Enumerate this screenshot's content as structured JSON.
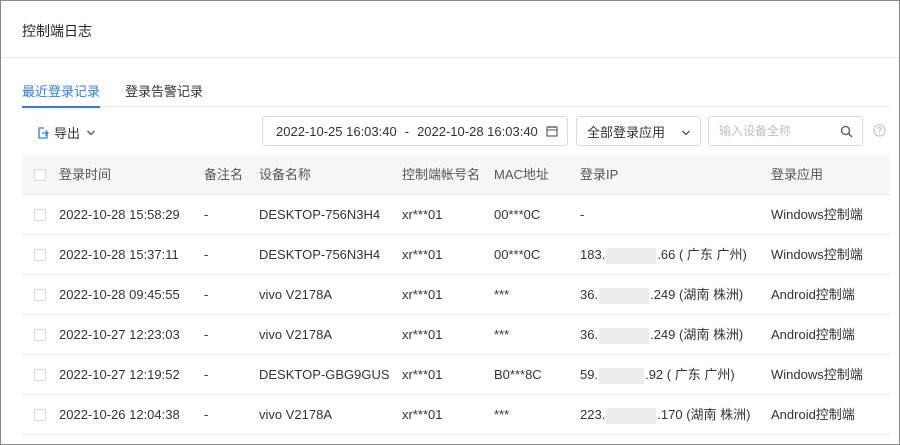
{
  "page": {
    "title": "控制端日志"
  },
  "tabs": [
    {
      "label": "最近登录记录",
      "active": true
    },
    {
      "label": "登录告警记录",
      "active": false
    }
  ],
  "toolbar": {
    "export_label": "导出",
    "date_start": "2022-10-25 16:03:40",
    "date_sep": "-",
    "date_end": "2022-10-28 16:03:40",
    "app_select_value": "全部登录应用",
    "search_placeholder": "输入设备全称"
  },
  "table": {
    "columns": [
      "登录时间",
      "备注名",
      "设备名称",
      "控制端帐号名",
      "MAC地址",
      "登录IP",
      "登录应用"
    ],
    "rows": [
      {
        "time": "2022-10-28 15:58:29",
        "remark": "-",
        "device": "DESKTOP-756N3H4",
        "account": "xr***01",
        "mac": "00***0C",
        "ip_prefix": "-",
        "ip_suffix": "",
        "app": "Windows控制端"
      },
      {
        "time": "2022-10-28 15:37:11",
        "remark": "-",
        "device": "DESKTOP-756N3H4",
        "account": "xr***01",
        "mac": "00***0C",
        "ip_prefix": "183.",
        "ip_suffix": ".66 ( 广东 广州)",
        "app": "Windows控制端"
      },
      {
        "time": "2022-10-28 09:45:55",
        "remark": "-",
        "device": "vivo V2178A",
        "account": "xr***01",
        "mac": "***",
        "ip_prefix": "36.",
        "ip_suffix": ".249 (湖南 株洲)",
        "app": "Android控制端"
      },
      {
        "time": "2022-10-27 12:23:03",
        "remark": "-",
        "device": "vivo V2178A",
        "account": "xr***01",
        "mac": "***",
        "ip_prefix": "36.",
        "ip_suffix": ".249 (湖南 株洲)",
        "app": "Android控制端"
      },
      {
        "time": "2022-10-27 12:19:52",
        "remark": "-",
        "device": "DESKTOP-GBG9GUS",
        "account": "xr***01",
        "mac": "B0***8C",
        "ip_prefix": "59.",
        "ip_suffix": ".92 ( 广东 广州)",
        "app": "Windows控制端"
      },
      {
        "time": "2022-10-26 12:04:38",
        "remark": "-",
        "device": "vivo V2178A",
        "account": "xr***01",
        "mac": "***",
        "ip_prefix": "223.",
        "ip_suffix": ".170 (湖南 株洲)",
        "app": "Android控制端"
      }
    ]
  },
  "colors": {
    "accent": "#2f7df6",
    "border": "#d9d9d9",
    "header_bg": "#f5f6f7"
  },
  "icons": [
    "export-icon",
    "chevron-down-icon",
    "calendar-icon",
    "search-icon",
    "help-icon"
  ]
}
